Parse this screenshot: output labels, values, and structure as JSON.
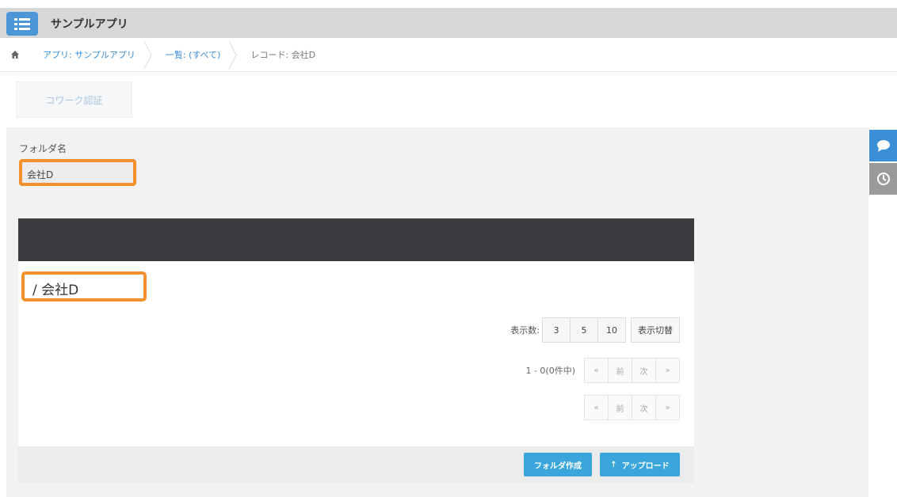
{
  "app": {
    "title": "サンプルアプリ"
  },
  "breadcrumb": {
    "app": "アプリ: サンプルアプリ",
    "list": "一覧: (すべて)",
    "record": "レコード: 会社D"
  },
  "tabs": {
    "cowork": "コワーク認証"
  },
  "field": {
    "label": "フォルダ名",
    "value": "会社D"
  },
  "panel": {
    "path": "/ 会社D",
    "display_count_label": "表示数:",
    "counts": [
      "3",
      "5",
      "10"
    ],
    "switch_label": "表示切替",
    "range_text": "1 - 0(0件中)",
    "pager": {
      "first": "«",
      "prev": "前",
      "next": "次",
      "last": "»"
    },
    "create_folder": "フォルダ作成",
    "upload": "アップロード"
  },
  "colors": {
    "accent": "#3aa6db",
    "highlight": "#f5912d",
    "header_dark": "#3a3c3f"
  }
}
